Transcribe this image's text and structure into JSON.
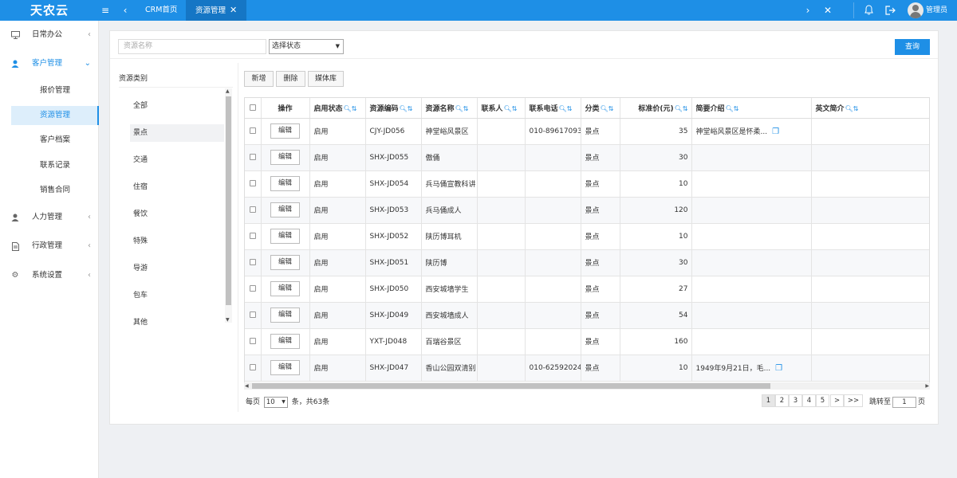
{
  "header": {
    "logo": "天农云",
    "tabs": [
      {
        "label": "CRM首页"
      },
      {
        "label": "资源管理",
        "close": "✕"
      }
    ],
    "admin_label": "管理员"
  },
  "sidebar": {
    "items": [
      {
        "label": "日常办公",
        "icon": "monitor-icon"
      },
      {
        "label": "客户管理",
        "icon": "user-icon"
      },
      {
        "label": "人力管理",
        "icon": "user-icon"
      },
      {
        "label": "行政管理",
        "icon": "document-icon"
      },
      {
        "label": "系统设置",
        "icon": "gear-icon"
      }
    ],
    "sub_items": [
      "报价管理",
      "资源管理",
      "客户档案",
      "联系记录",
      "销售合同"
    ]
  },
  "search": {
    "placeholder": "资源名称",
    "status_select": "选择状态",
    "query_label": "查询"
  },
  "categories": {
    "title": "资源类别",
    "items": [
      "全部",
      "景点",
      "交通",
      "住宿",
      "餐饮",
      "特殊",
      "导游",
      "包车",
      "其他"
    ],
    "selected": "景点"
  },
  "toolbar": {
    "add_label": "新增",
    "delete_label": "删除",
    "media_label": "媒体库"
  },
  "table": {
    "columns": [
      "操作",
      "启用状态",
      "资源编码",
      "资源名称",
      "联系人",
      "联系电话",
      "分类",
      "标准价(元)",
      "简要介绍",
      "英文简介"
    ],
    "edit_label": "编辑",
    "rows": [
      {
        "status": "启用",
        "code": "CJY-JD056",
        "name": "神堂峪风景区",
        "contact": "",
        "phone": "010-89617093",
        "category": "景点",
        "price": "35",
        "intro": "神堂峪风景区是怀柔...",
        "en_intro": ""
      },
      {
        "status": "启用",
        "code": "SHX-JD055",
        "name": "傲俑",
        "contact": "",
        "phone": "",
        "category": "景点",
        "price": "30",
        "intro": "",
        "en_intro": ""
      },
      {
        "status": "启用",
        "code": "SHX-JD054",
        "name": "兵马俑宣教科讲",
        "contact": "",
        "phone": "",
        "category": "景点",
        "price": "10",
        "intro": "",
        "en_intro": ""
      },
      {
        "status": "启用",
        "code": "SHX-JD053",
        "name": "兵马俑成人",
        "contact": "",
        "phone": "",
        "category": "景点",
        "price": "120",
        "intro": "",
        "en_intro": ""
      },
      {
        "status": "启用",
        "code": "SHX-JD052",
        "name": "陕历博耳机",
        "contact": "",
        "phone": "",
        "category": "景点",
        "price": "10",
        "intro": "",
        "en_intro": ""
      },
      {
        "status": "启用",
        "code": "SHX-JD051",
        "name": "陕历博",
        "contact": "",
        "phone": "",
        "category": "景点",
        "price": "30",
        "intro": "",
        "en_intro": ""
      },
      {
        "status": "启用",
        "code": "SHX-JD050",
        "name": "西安城墙学生",
        "contact": "",
        "phone": "",
        "category": "景点",
        "price": "27",
        "intro": "",
        "en_intro": ""
      },
      {
        "status": "启用",
        "code": "SHX-JD049",
        "name": "西安城墙成人",
        "contact": "",
        "phone": "",
        "category": "景点",
        "price": "54",
        "intro": "",
        "en_intro": ""
      },
      {
        "status": "启用",
        "code": "YXT-JD048",
        "name": "百瑞谷景区",
        "contact": "",
        "phone": "",
        "category": "景点",
        "price": "160",
        "intro": "",
        "en_intro": ""
      },
      {
        "status": "启用",
        "code": "SHX-JD047",
        "name": "香山公园双清别",
        "contact": "",
        "phone": "010-62592024",
        "category": "景点",
        "price": "10",
        "intro": "1949年9月21日，毛...",
        "en_intro": ""
      }
    ]
  },
  "pagination": {
    "per_page_label": "每页",
    "per_page_value": "10",
    "total_label": "条，共63条",
    "pages": [
      "1",
      "2",
      "3",
      "4",
      "5",
      ">",
      ">>"
    ],
    "current": "1",
    "jump_label": "跳转至",
    "jump_value": "1",
    "page_suffix": "页"
  }
}
